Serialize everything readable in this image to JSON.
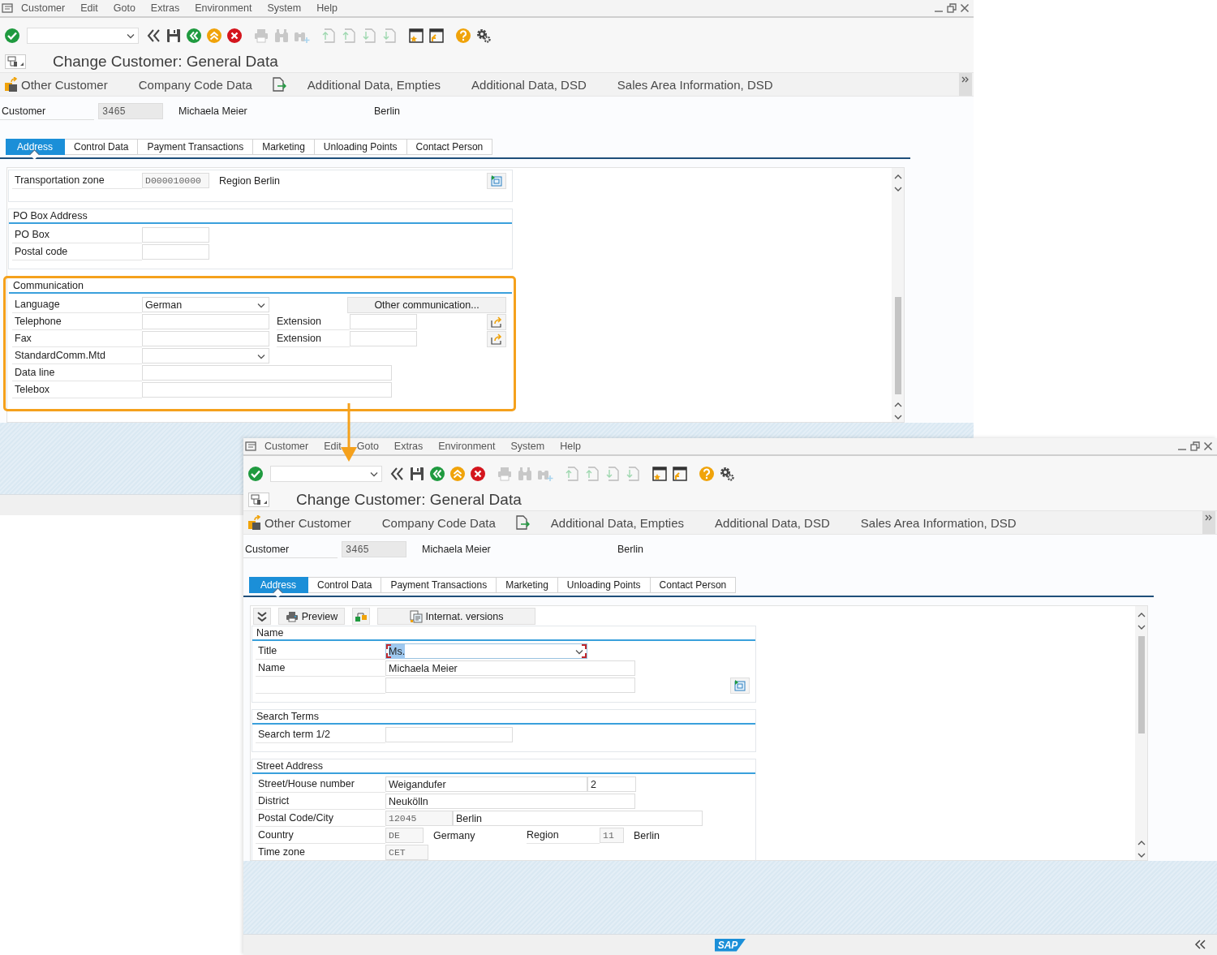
{
  "windows": [
    {
      "menu": [
        "Customer",
        "Edit",
        "Goto",
        "Extras",
        "Environment",
        "System",
        "Help"
      ],
      "toolbar": [
        {
          "kind": "enter",
          "disabled": false
        },
        {
          "kind": "command-field",
          "disabled": false
        },
        {
          "kind": "collapse",
          "disabled": false
        },
        {
          "kind": "save",
          "disabled": false
        },
        {
          "kind": "back",
          "disabled": false
        },
        {
          "kind": "exit",
          "disabled": false
        },
        {
          "kind": "cancel",
          "disabled": false
        },
        {
          "kind": "print",
          "disabled": true
        },
        {
          "kind": "find",
          "disabled": true
        },
        {
          "kind": "find-next",
          "disabled": true
        },
        {
          "kind": "first-page",
          "disabled": true
        },
        {
          "kind": "previous-page",
          "disabled": true
        },
        {
          "kind": "next-page",
          "disabled": true
        },
        {
          "kind": "last-page",
          "disabled": true
        },
        {
          "kind": "new-session",
          "disabled": false
        },
        {
          "kind": "shortcut",
          "disabled": false
        },
        {
          "kind": "help",
          "disabled": false
        },
        {
          "kind": "settings",
          "disabled": false
        }
      ],
      "title": "Change Customer: General Data",
      "app_toolbar": [
        {
          "kind": "icon-text",
          "label": "Other Customer"
        },
        {
          "kind": "text",
          "label": "Company Code Data"
        },
        {
          "kind": "icon"
        },
        {
          "kind": "text",
          "label": "Additional Data, Empties"
        },
        {
          "kind": "text",
          "label": "Additional Data, DSD"
        },
        {
          "kind": "text",
          "label": "Sales Area Information, DSD"
        }
      ],
      "header": {
        "label": "Customer",
        "number": "3465",
        "name": "Michaela Meier",
        "city": "Berlin"
      },
      "tabs": [
        {
          "label": "Address",
          "selected": true
        },
        {
          "label": "Control Data",
          "selected": false
        },
        {
          "label": "Payment Transactions",
          "selected": false
        },
        {
          "label": "Marketing",
          "selected": false
        },
        {
          "label": "Unloading Points",
          "selected": false
        },
        {
          "label": "Contact Person",
          "selected": false
        }
      ],
      "content": {
        "sections": [
          {
            "highlighted": false,
            "rows": [
              {
                "label": "Transportation zone",
                "cells": [
                  {
                    "kind": "readonly-short",
                    "value": "D000010000"
                  },
                  {
                    "kind": "text",
                    "value": "Region Berlin"
                  },
                  {
                    "kind": "insert-button"
                  }
                ]
              }
            ]
          },
          {
            "title": "PO Box Address",
            "highlighted": false,
            "rows": [
              {
                "label": "PO Box",
                "cells": [
                  {
                    "kind": "input-short"
                  }
                ]
              },
              {
                "label": "Postal code",
                "cells": [
                  {
                    "kind": "input-short"
                  }
                ]
              }
            ]
          },
          {
            "title": "Communication",
            "highlighted": true,
            "rows": [
              {
                "label": "Language",
                "cells": [
                  {
                    "kind": "dropdown-medium",
                    "value": "German",
                    "focused": false
                  },
                  {
                    "kind": "button",
                    "value": "Other communication..."
                  }
                ]
              },
              {
                "label": "Telephone",
                "cells": [
                  {
                    "kind": "input-medium"
                  },
                  {
                    "kind": "label",
                    "value": "Extension"
                  },
                  {
                    "kind": "input-short"
                  },
                  {
                    "kind": "share-button"
                  }
                ]
              },
              {
                "label": "Fax",
                "cells": [
                  {
                    "kind": "input-medium"
                  },
                  {
                    "kind": "label",
                    "value": "Extension"
                  },
                  {
                    "kind": "input-short"
                  },
                  {
                    "kind": "share-button"
                  }
                ]
              },
              {
                "label": "StandardComm.Mtd",
                "cells": [
                  {
                    "kind": "dropdown-medium",
                    "focused": false
                  }
                ]
              },
              {
                "label": "Data line",
                "cells": [
                  {
                    "kind": "input-long"
                  }
                ]
              },
              {
                "label": "Telebox",
                "cells": [
                  {
                    "kind": "input-long"
                  }
                ]
              }
            ]
          }
        ]
      }
    },
    {
      "menu": [
        "Customer",
        "Edit",
        "Goto",
        "Extras",
        "Environment",
        "System",
        "Help"
      ],
      "toolbar": [
        {
          "kind": "enter",
          "disabled": false
        },
        {
          "kind": "command-field",
          "disabled": false
        },
        {
          "kind": "collapse",
          "disabled": false
        },
        {
          "kind": "save",
          "disabled": false
        },
        {
          "kind": "back",
          "disabled": false
        },
        {
          "kind": "exit",
          "disabled": false
        },
        {
          "kind": "cancel",
          "disabled": false
        },
        {
          "kind": "print",
          "disabled": true
        },
        {
          "kind": "find",
          "disabled": true
        },
        {
          "kind": "find-next",
          "disabled": true
        },
        {
          "kind": "first-page",
          "disabled": true
        },
        {
          "kind": "previous-page",
          "disabled": true
        },
        {
          "kind": "next-page",
          "disabled": true
        },
        {
          "kind": "last-page",
          "disabled": true
        },
        {
          "kind": "new-session",
          "disabled": false
        },
        {
          "kind": "shortcut",
          "disabled": false
        },
        {
          "kind": "help",
          "disabled": false
        },
        {
          "kind": "settings",
          "disabled": false
        }
      ],
      "title": "Change Customer: General Data",
      "app_toolbar": [
        {
          "kind": "icon-text",
          "label": "Other Customer"
        },
        {
          "kind": "text",
          "label": "Company Code Data"
        },
        {
          "kind": "icon"
        },
        {
          "kind": "text",
          "label": "Additional Data, Empties"
        },
        {
          "kind": "text",
          "label": "Additional Data, DSD"
        },
        {
          "kind": "text",
          "label": "Sales Area Information, DSD"
        }
      ],
      "header": {
        "label": "Customer",
        "number": "3465",
        "name": "Michaela Meier",
        "city": "Berlin"
      },
      "tabs": [
        {
          "label": "Address",
          "selected": true
        },
        {
          "label": "Control Data",
          "selected": false
        },
        {
          "label": "Payment Transactions",
          "selected": false
        },
        {
          "label": "Marketing",
          "selected": false
        },
        {
          "label": "Unloading Points",
          "selected": false
        },
        {
          "label": "Contact Person",
          "selected": false
        }
      ],
      "content": {
        "form_toolbar": [
          {
            "kind": "expand"
          },
          {
            "kind": "print",
            "label": "Preview"
          },
          {
            "kind": "hierarchy"
          },
          {
            "kind": "versions",
            "label": "Internat. versions"
          }
        ],
        "sections": [
          {
            "title": "Name",
            "highlighted": false,
            "rows": [
              {
                "label": "Title",
                "cells": [
                  {
                    "kind": "dropdown-wide",
                    "value": "Ms.",
                    "focused": true
                  }
                ]
              },
              {
                "label": "Name",
                "cells": [
                  {
                    "kind": "input-long",
                    "value": "Michaela Meier"
                  }
                ]
              },
              {
                "cells": [
                  {
                    "kind": "input-long"
                  },
                  {
                    "kind": "insert-button"
                  }
                ]
              }
            ]
          },
          {
            "title": "Search Terms",
            "highlighted": false,
            "rows": [
              {
                "label": "Search term 1/2",
                "cells": [
                  {
                    "kind": "input-medium"
                  }
                ]
              }
            ]
          },
          {
            "title": "Street Address",
            "highlighted": false,
            "rows": [
              {
                "label": "Street/House number",
                "cells": [
                  {
                    "kind": "input-wide",
                    "value": "Weigandufer"
                  },
                  {
                    "kind": "input-mini",
                    "value": "2"
                  }
                ]
              },
              {
                "label": "District",
                "cells": [
                  {
                    "kind": "input-long",
                    "value": "Neukölln"
                  }
                ]
              },
              {
                "label": "Postal Code/City",
                "cells": [
                  {
                    "kind": "readonly-short",
                    "value": "12045"
                  },
                  {
                    "kind": "input-long",
                    "value": "Berlin"
                  }
                ]
              },
              {
                "label": "Country",
                "cells": [
                  {
                    "kind": "readonly-xs",
                    "value": "DE"
                  },
                  {
                    "kind": "text",
                    "value": "Germany"
                  },
                  {
                    "kind": "label",
                    "value": "Region"
                  },
                  {
                    "kind": "readonly-tiny",
                    "value": "11"
                  },
                  {
                    "kind": "text",
                    "value": "Berlin"
                  }
                ]
              },
              {
                "label": "Time zone",
                "cells": [
                  {
                    "kind": "readonly-s",
                    "value": "CET"
                  }
                ]
              }
            ]
          }
        ]
      },
      "status_bar": {
        "logo": "SAP"
      }
    }
  ]
}
